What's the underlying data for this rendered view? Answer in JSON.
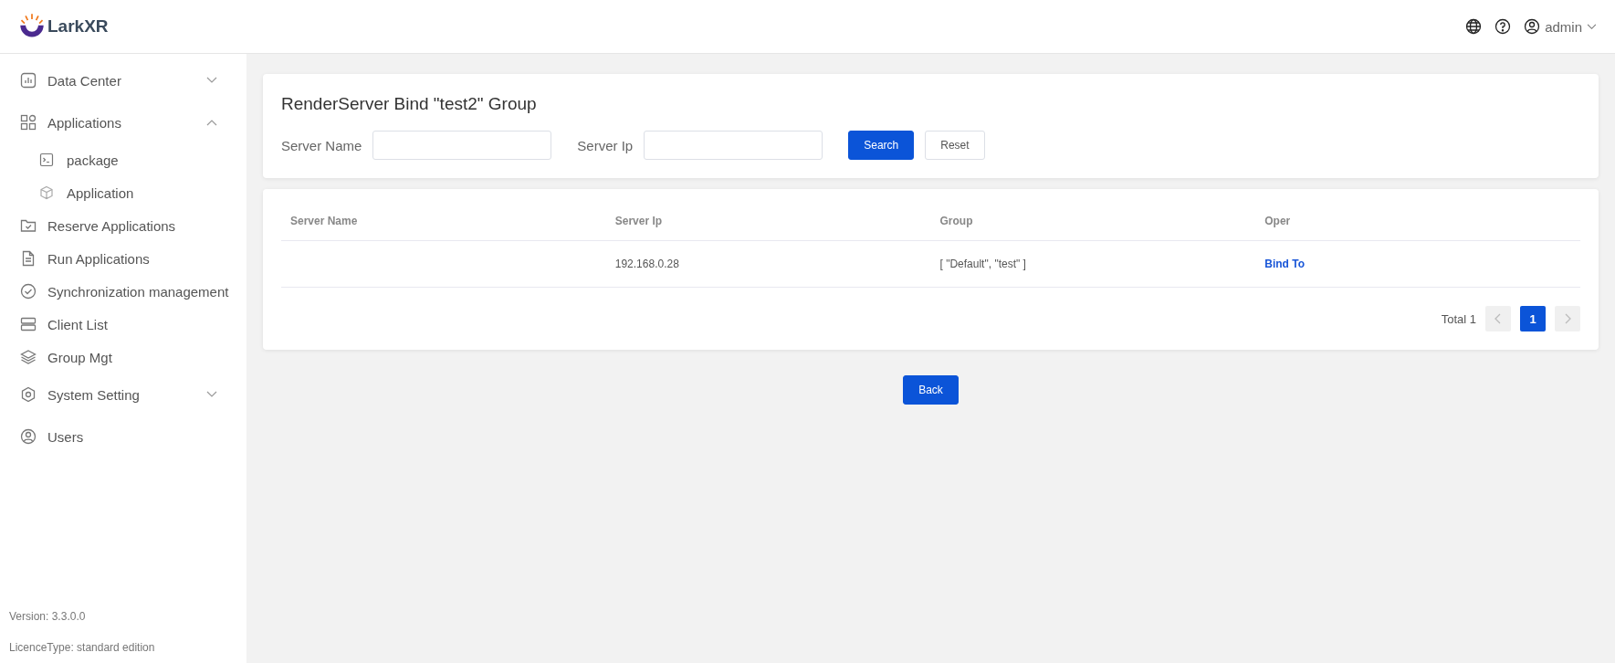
{
  "header": {
    "logo": "LarkXR",
    "user": "admin"
  },
  "sidebar": {
    "items": [
      {
        "label": "Data Center",
        "expanded": false
      },
      {
        "label": "Applications",
        "expanded": true,
        "children": [
          {
            "label": "package"
          },
          {
            "label": "Application"
          }
        ]
      },
      {
        "label": "Reserve Applications"
      },
      {
        "label": "Run Applications"
      },
      {
        "label": "Synchronization management"
      },
      {
        "label": "Client List"
      },
      {
        "label": "Group Mgt"
      },
      {
        "label": "System Setting",
        "expanded": false
      },
      {
        "label": "Users"
      }
    ],
    "footer": [
      "Version: 3.3.0.0",
      "LicenceType: standard edition"
    ]
  },
  "filter": {
    "title": "RenderServer Bind \"test2\" Group",
    "fields": [
      {
        "label": "Server Name"
      },
      {
        "label": "Server Ip"
      }
    ],
    "buttons": [
      "Search",
      "Reset"
    ]
  },
  "table": {
    "columns": [
      "Server Name",
      "Server Ip",
      "Group",
      "Oper"
    ],
    "rows": [
      {
        "cells": [
          "",
          "192.168.0.28",
          "[ \"Default\", \"test\" ]"
        ],
        "action": "Bind To"
      }
    ]
  },
  "pagination": {
    "total": "Total 1",
    "prev_disabled": true,
    "next_disabled": true,
    "pages": [
      {
        "label": "1",
        "selected": true
      }
    ]
  },
  "back_button": "Back"
}
